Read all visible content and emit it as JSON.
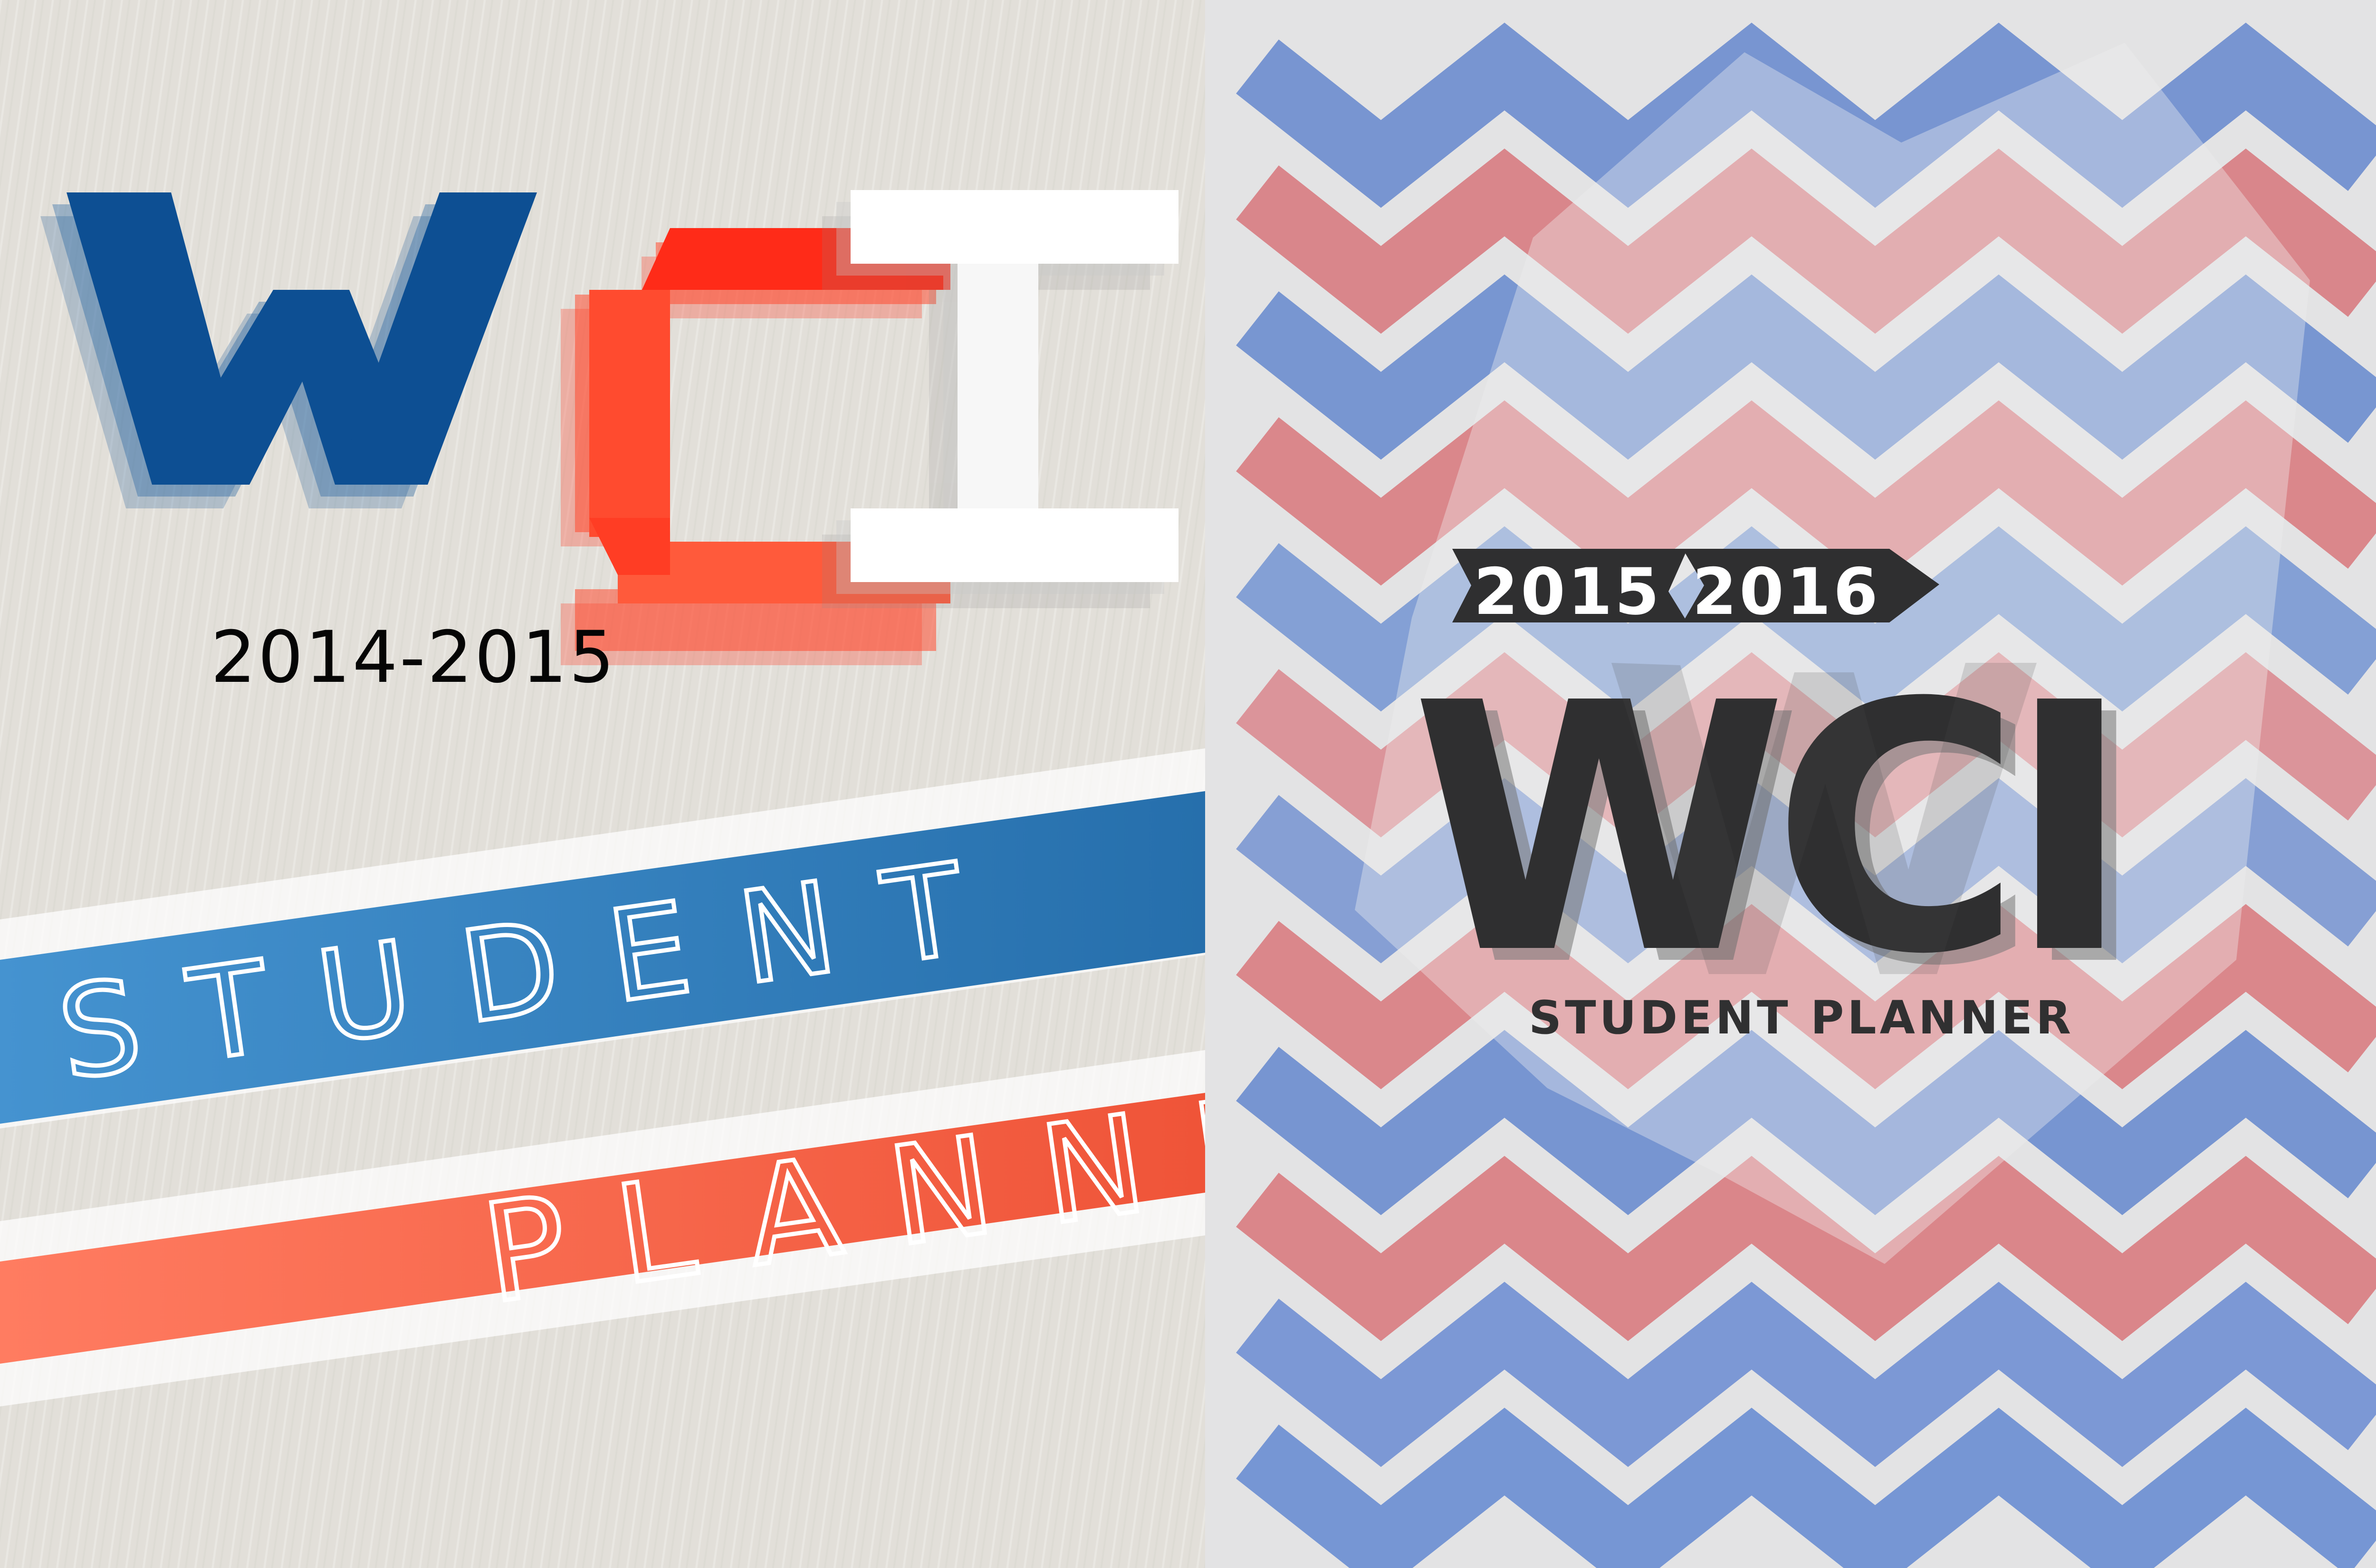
{
  "left_cover": {
    "logo_text": "WCI",
    "year": "2014-2015",
    "band_blue_text": "STUDENT",
    "band_red_text": "PLANNER",
    "colors": {
      "blue": "#0d4f93",
      "red": "#ff3d24",
      "band_blue": "#2e79bb",
      "band_red": "#f76d52",
      "paper": "#e2dfd9"
    }
  },
  "right_cover": {
    "logo_text": "WCI",
    "year_start": "2015",
    "year_end": "2016",
    "subtitle": "STUDENT PLANNER",
    "colors": {
      "chevron_blue": "#5e87cf",
      "chevron_red": "#d87076",
      "logo": "#2f2f30",
      "background": "#e3e3e4"
    }
  }
}
